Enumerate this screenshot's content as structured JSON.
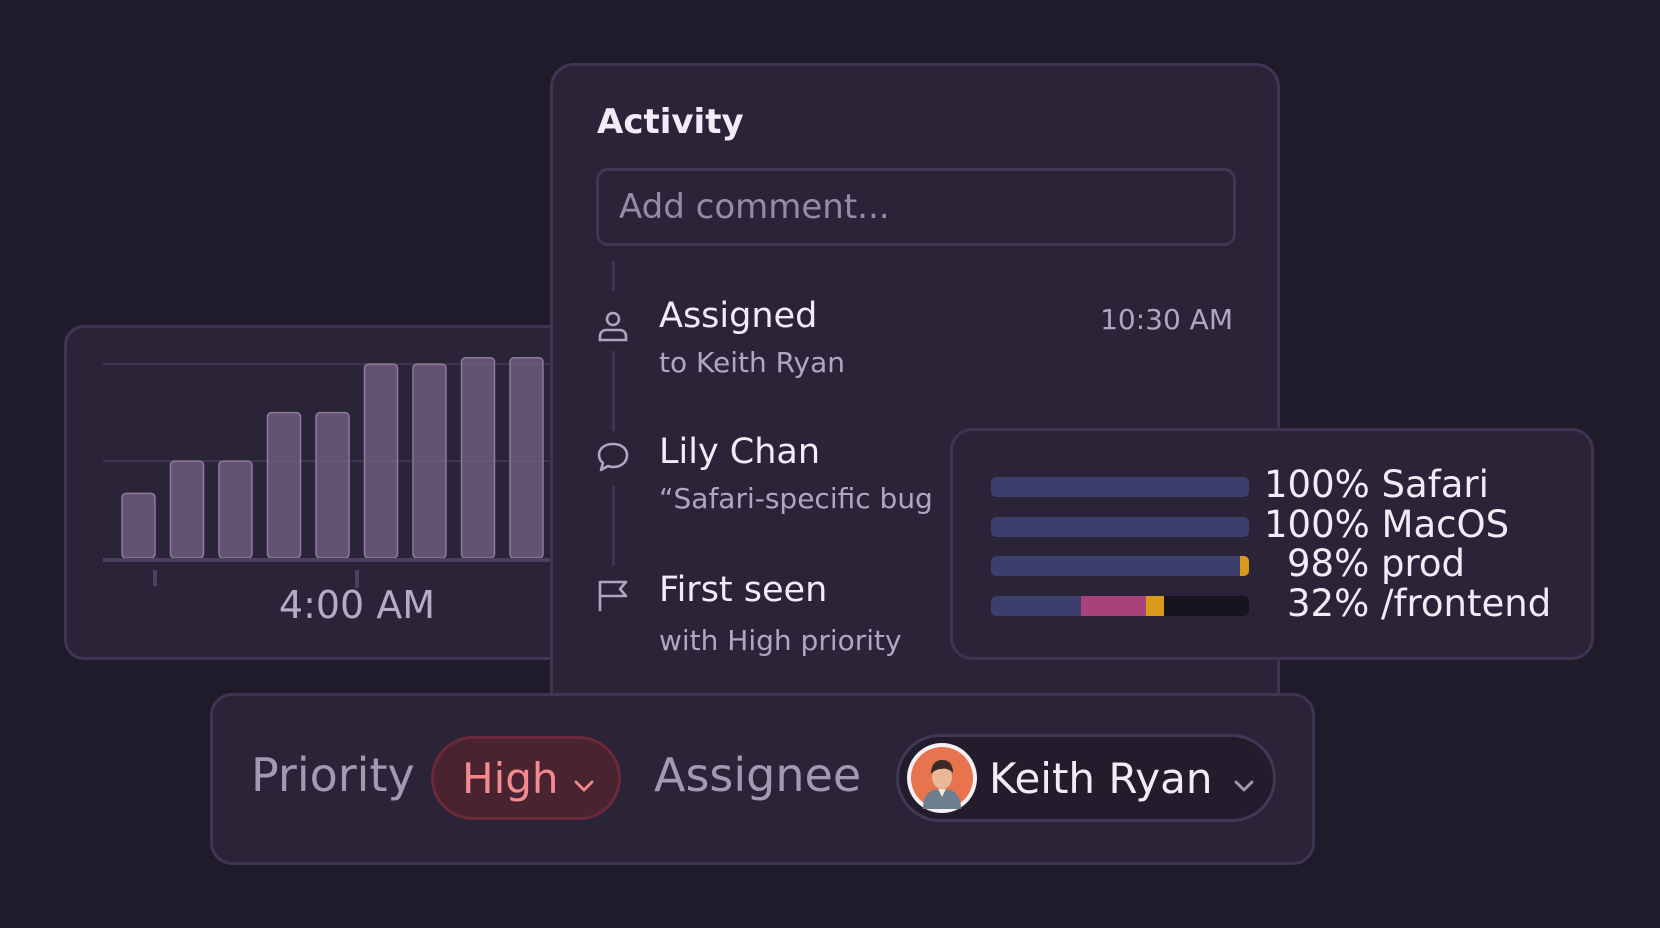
{
  "activity": {
    "title": "Activity",
    "comment_placeholder": "Add comment...",
    "events": [
      {
        "icon": "user-icon",
        "title": "Assigned",
        "subtitle": "to Keith Ryan",
        "time": "10:30 AM"
      },
      {
        "icon": "comment-icon",
        "title": "Lily Chan",
        "subtitle": "“Safari-specific bug"
      },
      {
        "icon": "flag-icon",
        "title": "First seen",
        "subtitle": "with High priority"
      }
    ]
  },
  "chart_data": {
    "type": "bar",
    "values": [
      2.0,
      3.0,
      3.0,
      4.5,
      4.5,
      6.0,
      6.0,
      6.2,
      6.2
    ],
    "x_tick_labels": [
      "4:00 AM"
    ],
    "ylim": [
      0,
      6.5
    ],
    "grid": true,
    "bar_color": "#7a6489",
    "gridline_color": "#3f374f"
  },
  "breakdown": {
    "rows": [
      {
        "percent": "100%",
        "label": "Safari",
        "value": 1.0,
        "segments": [
          {
            "fraction": 1.0,
            "color": "#3c3f6e"
          }
        ]
      },
      {
        "percent": "100%",
        "label": "MacOS",
        "value": 1.0,
        "segments": [
          {
            "fraction": 1.0,
            "color": "#3c3f6e"
          }
        ]
      },
      {
        "percent": "98%",
        "label": "prod",
        "value": 0.98,
        "segments": [
          {
            "fraction": 0.965,
            "color": "#3c3f6e"
          },
          {
            "fraction": 0.035,
            "color": "#d99a1c"
          }
        ]
      },
      {
        "percent": "32%",
        "label": "/frontend",
        "value": 0.32,
        "segments": [
          {
            "fraction": 0.35,
            "color": "#3c3f6e"
          },
          {
            "fraction": 0.25,
            "color": "#a7427a"
          },
          {
            "fraction": 0.07,
            "color": "#d99a1c"
          }
        ]
      }
    ]
  },
  "fields": {
    "priority_label": "Priority",
    "priority_value": "High",
    "assignee_label": "Assignee",
    "assignee_value": "Keith Ryan"
  },
  "colors": {
    "background": "#201b2a",
    "card": "#2b2438",
    "priority_high": "#f38a8f",
    "priority_high_bg": "#4a2331"
  }
}
